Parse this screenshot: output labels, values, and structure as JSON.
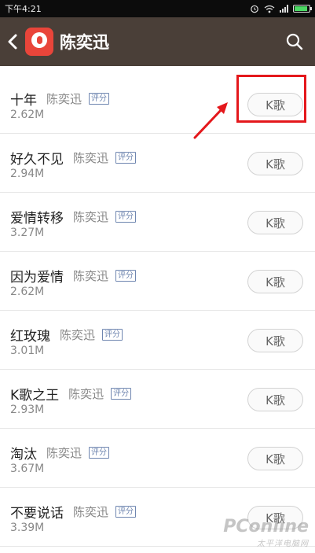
{
  "status_bar": {
    "time": "下午4:21",
    "icons": [
      "alarm-icon",
      "wifi-icon",
      "signal-icon",
      "battery-icon"
    ]
  },
  "header": {
    "title": "陈奕迅",
    "back_icon": "back-chevron-icon",
    "search_icon": "search-icon",
    "background_color": "#4a3f38",
    "logo_color": "#e9453a"
  },
  "songs": [
    {
      "title": "十年",
      "artist": "陈奕迅",
      "badge": "评分",
      "size": "2.62M",
      "button": "K歌"
    },
    {
      "title": "好久不见",
      "artist": "陈奕迅",
      "badge": "评分",
      "size": "2.94M",
      "button": "K歌"
    },
    {
      "title": "爱情转移",
      "artist": "陈奕迅",
      "badge": "评分",
      "size": "3.27M",
      "button": "K歌"
    },
    {
      "title": "因为爱情",
      "artist": "陈奕迅",
      "badge": "评分",
      "size": "2.62M",
      "button": "K歌"
    },
    {
      "title": "红玫瑰",
      "artist": "陈奕迅",
      "badge": "评分",
      "size": "3.01M",
      "button": "K歌"
    },
    {
      "title": "K歌之王",
      "artist": "陈奕迅",
      "badge": "评分",
      "size": "2.93M",
      "button": "K歌"
    },
    {
      "title": "淘汰",
      "artist": "陈奕迅",
      "badge": "评分",
      "size": "3.67M",
      "button": "K歌"
    },
    {
      "title": "不要说话",
      "artist": "陈奕迅",
      "badge": "评分",
      "size": "3.39M",
      "button": "K歌"
    }
  ],
  "annotation": {
    "color": "#e4181c"
  },
  "watermark": {
    "line1": "PConline",
    "line2": "太平洋电脑网"
  }
}
